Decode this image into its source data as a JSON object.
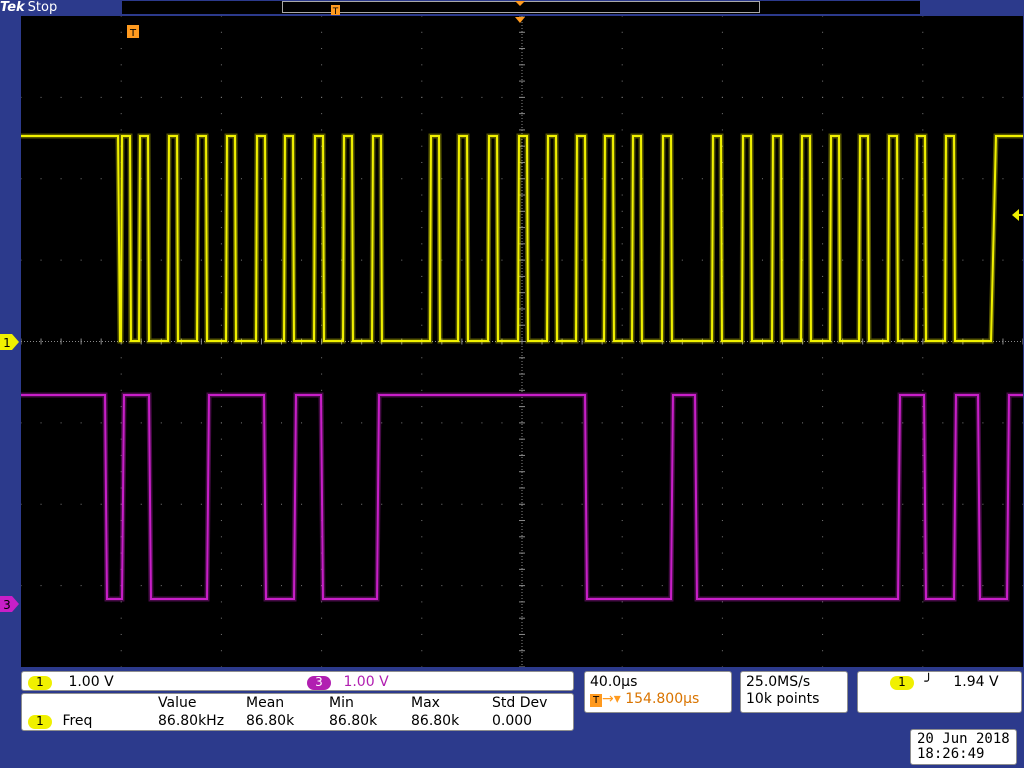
{
  "status_bar": {
    "brand": "Tek",
    "state": "Stop"
  },
  "markers": {
    "ch1": "1",
    "ch3": "3",
    "trigger_T": "T"
  },
  "channels": {
    "ch1": {
      "label": "1",
      "scale": "1.00 V",
      "color": "#f0f000"
    },
    "ch3": {
      "label": "3",
      "scale": "1.00 V",
      "color": "#c81fc8"
    }
  },
  "timebase": {
    "scale": "40.0µs",
    "position": "154.800µs"
  },
  "acquisition": {
    "rate": "25.0MS/s",
    "points": "10k points"
  },
  "trigger": {
    "channel": "1",
    "slope": "rising",
    "level": "1.94 V"
  },
  "measurement": {
    "headers": [
      "Value",
      "Mean",
      "Min",
      "Max",
      "Std Dev"
    ],
    "channel": "1",
    "name": "Freq",
    "values": [
      "86.80kHz",
      "86.80k",
      "86.80k",
      "86.80k",
      "0.000"
    ]
  },
  "datetime": {
    "date": "20 Jun 2018",
    "time": "18:26:49"
  }
}
